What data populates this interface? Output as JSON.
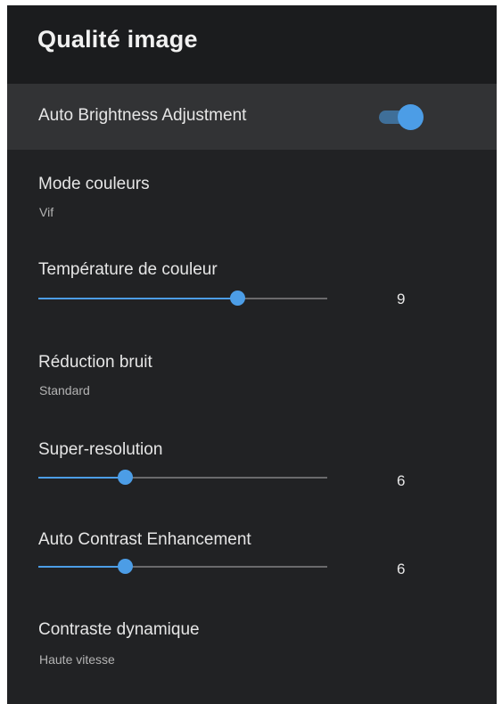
{
  "header": {
    "title": "Qualité image"
  },
  "settings": {
    "auto_brightness": {
      "label": "Auto Brightness Adjustment",
      "enabled": true
    },
    "color_mode": {
      "label": "Mode couleurs",
      "value": "Vif"
    },
    "color_temperature": {
      "label": "Température de couleur",
      "value": "9",
      "fill_fraction": 0.687
    },
    "noise_reduction": {
      "label": "Réduction bruit",
      "value": "Standard"
    },
    "super_resolution": {
      "label": "Super-resolution",
      "value": "6",
      "fill_fraction": 0.298
    },
    "auto_contrast": {
      "label": "Auto Contrast Enhancement",
      "value": "6",
      "fill_fraction": 0.298
    },
    "dynamic_contrast": {
      "label": "Contraste dynamique",
      "value": "Haute vitesse"
    }
  },
  "colors": {
    "accent": "#4c9de6",
    "panel_background": "#212224",
    "highlight_row": "#323335"
  }
}
